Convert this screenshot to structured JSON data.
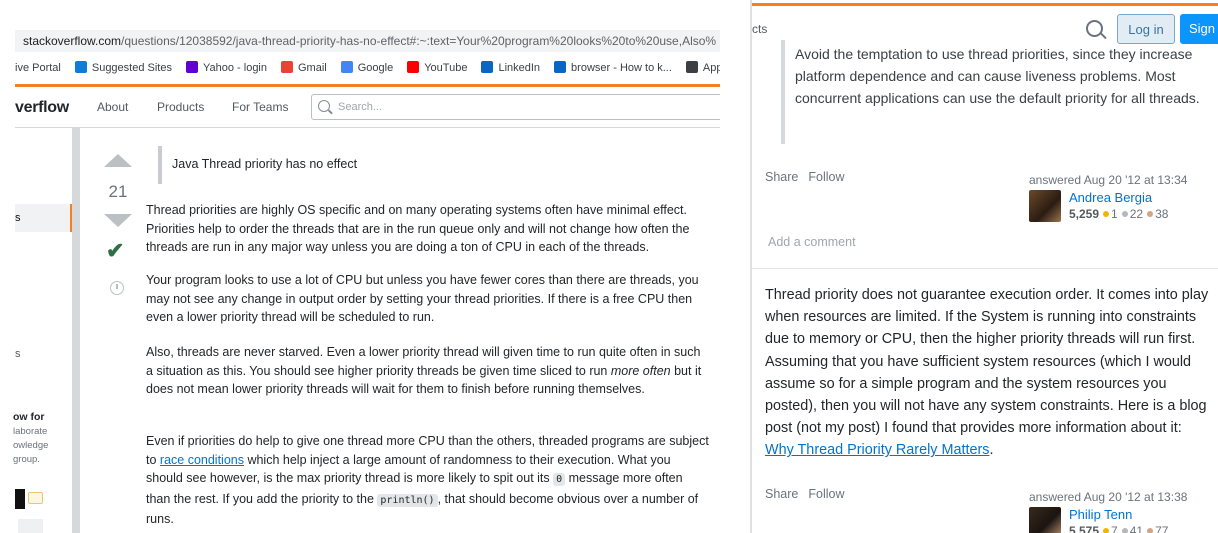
{
  "left": {
    "url_domain": "stackoverflow.com",
    "url_path": "/questions/12038592/java-thread-priority-has-no-effect#:~:text=Your%20program%20looks%20to%20use,Also%",
    "bookmarks": [
      {
        "label": "ive Portal",
        "icon": "portal-icon",
        "color": ""
      },
      {
        "label": "Suggested Sites",
        "icon": "bing-icon",
        "color": "#0f7cd7"
      },
      {
        "label": "Yahoo - login",
        "icon": "yahoo-mail-icon",
        "color": "#6001d2"
      },
      {
        "label": "Gmail",
        "icon": "gmail-icon",
        "color": "#ea4335"
      },
      {
        "label": "Google",
        "icon": "google-icon",
        "color": "#4285f4"
      },
      {
        "label": "YouTube",
        "icon": "youtube-icon",
        "color": "#ff0000"
      },
      {
        "label": "LinkedIn",
        "icon": "linkedin-icon",
        "color": "#0a66c2"
      },
      {
        "label": "browser - How to k...",
        "icon": "bracket-icon",
        "color": "#0a66c2"
      },
      {
        "label": "App",
        "icon": "globe-icon",
        "color": "#3c4043"
      }
    ],
    "logo": "verflow",
    "nav": {
      "about": "About",
      "products": "Products",
      "for_teams": "For Teams"
    },
    "search_placeholder": "Search...",
    "sidebar": {
      "active_item": "s",
      "item2": "s",
      "collective_title": "ow for",
      "collective_lines": [
        "laborate",
        "owledge",
        "group."
      ]
    },
    "vote_count": "21",
    "quote": "Java Thread priority has no effect",
    "paragraphs": {
      "p1": "Thread priorities are highly OS specific and on many operating systems often have minimal effect. Priorities help to order the threads that are in the run queue only and will not change how often the threads are run in any major way unless you are doing a ton of CPU in each of the threads.",
      "p2": "Your program looks to use a lot of CPU but unless you have fewer cores than there are threads, you may not see any change in output order by setting your thread priorities. If there is a free CPU then even a lower priority thread will be scheduled to run.",
      "p3_a": "Also, threads are never starved. Even a lower priority thread will given time to run quite often in such a situation as this. You should see higher priority threads be given time sliced to run ",
      "p3_em": "more often",
      "p3_b": " but it does not mean lower priority threads will wait for them to finish before running themselves.",
      "p4_a": "Even if priorities do help to give one thread more CPU than the others, threaded programs are subject to ",
      "p4_link": "race conditions",
      "p4_b": " which help inject a large amount of randomness to their execution. What you should see however, is the max priority thread is more likely to spit out its ",
      "p4_code1": "0",
      "p4_c": " message more often than the rest. If you add the priority to the ",
      "p4_code2": "println()",
      "p4_d": ", that should become obvious over a number of runs."
    }
  },
  "right": {
    "header_fragment": "cts",
    "login": "Log in",
    "signup": "Sign",
    "quote": "Avoid the temptation to use thread priorities, since they increase platform dependence and can cause liveness problems. Most concurrent applications can use the default priority for all threads.",
    "share": "Share",
    "follow": "Follow",
    "answer1": {
      "answered": "answered Aug 20 '12 at 13:34",
      "user": "Andrea Bergia",
      "rep": "5,259",
      "gold": "1",
      "silver": "22",
      "bronze": "38"
    },
    "add_comment": "Add a comment",
    "answer2_a": "Thread priority does not guarantee execution order. It comes into play when resources are limited. If the System is running into constraints due to memory or CPU, then the higher priority threads will run first. Assuming that you have sufficient system resources (which I would assume so for a simple program and the system resources you posted), then you will not have any system constraints. Here is a blog post (not my post) I found that provides more information about it: ",
    "answer2_link": "Why Thread Priority Rarely Matters",
    "answer2_b": ".",
    "answer2_user": {
      "answered": "answered Aug 20 '12 at 13:38",
      "user": "Philip Tenn",
      "rep": "5,575",
      "gold": "7",
      "silver": "41",
      "bronze": "77"
    }
  }
}
